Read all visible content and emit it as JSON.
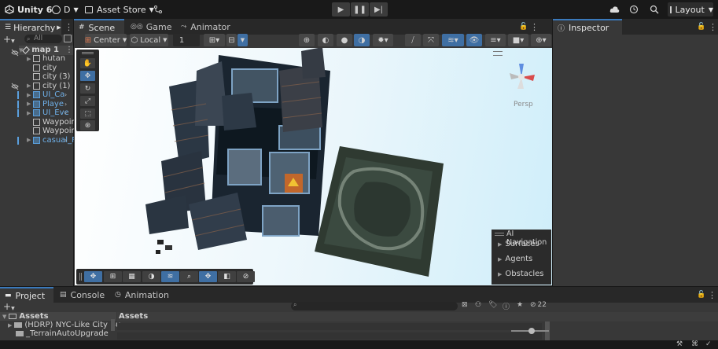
{
  "toolbar": {
    "app_title": "Unity 6",
    "account": "D",
    "asset_store": "Asset Store",
    "layout": "Layout"
  },
  "hierarchy": {
    "tab_label": "Hierarchy",
    "search_placeholder": "All",
    "scene_name": "map 1",
    "items": [
      {
        "label": "hutan",
        "type": "object",
        "expandable": true
      },
      {
        "label": "city",
        "type": "object",
        "expandable": false
      },
      {
        "label": "city (3)",
        "type": "object",
        "expandable": false
      },
      {
        "label": "city (1)",
        "type": "object",
        "expandable": true
      },
      {
        "label": "UI_Ca",
        "type": "prefab",
        "expandable": true
      },
      {
        "label": "Playe",
        "type": "prefab",
        "expandable": true
      },
      {
        "label": "UI_Eve",
        "type": "prefab",
        "expandable": true
      },
      {
        "label": "Waypoin",
        "type": "object",
        "expandable": false
      },
      {
        "label": "Waypoin",
        "type": "object",
        "expandable": false
      },
      {
        "label": "casual_F",
        "type": "prefab",
        "expandable": true
      }
    ]
  },
  "scene_tabs": [
    {
      "label": "Scene",
      "icon": "grid-icon",
      "active": true
    },
    {
      "label": "Game",
      "icon": "gamepad-icon",
      "active": false
    },
    {
      "label": "Animator",
      "icon": "animator-icon",
      "active": false
    }
  ],
  "scene_toolbar": {
    "pivot": "Center",
    "space": "Local",
    "grid_size": "1"
  },
  "scene_view": {
    "gizmo_label": "Persp"
  },
  "ai_navigation": {
    "title": "AI Navigation",
    "items": [
      "Surfaces",
      "Agents",
      "Obstacles"
    ]
  },
  "inspector": {
    "tab_label": "Inspector"
  },
  "bottom_tabs": [
    {
      "label": "Project",
      "active": true
    },
    {
      "label": "Console",
      "active": false
    },
    {
      "label": "Animation",
      "active": false
    }
  ],
  "project": {
    "root_label": "Assets",
    "breadcrumb": "Assets",
    "hidden_count": "22",
    "folders": [
      "(HDRP) NYC-Like City Bu",
      "_TerrainAutoUpgrade"
    ]
  },
  "colors": {
    "accent": "#3a79bb",
    "prefab_blue": "#5aa0de",
    "scene_sky": "#dff3fb"
  }
}
